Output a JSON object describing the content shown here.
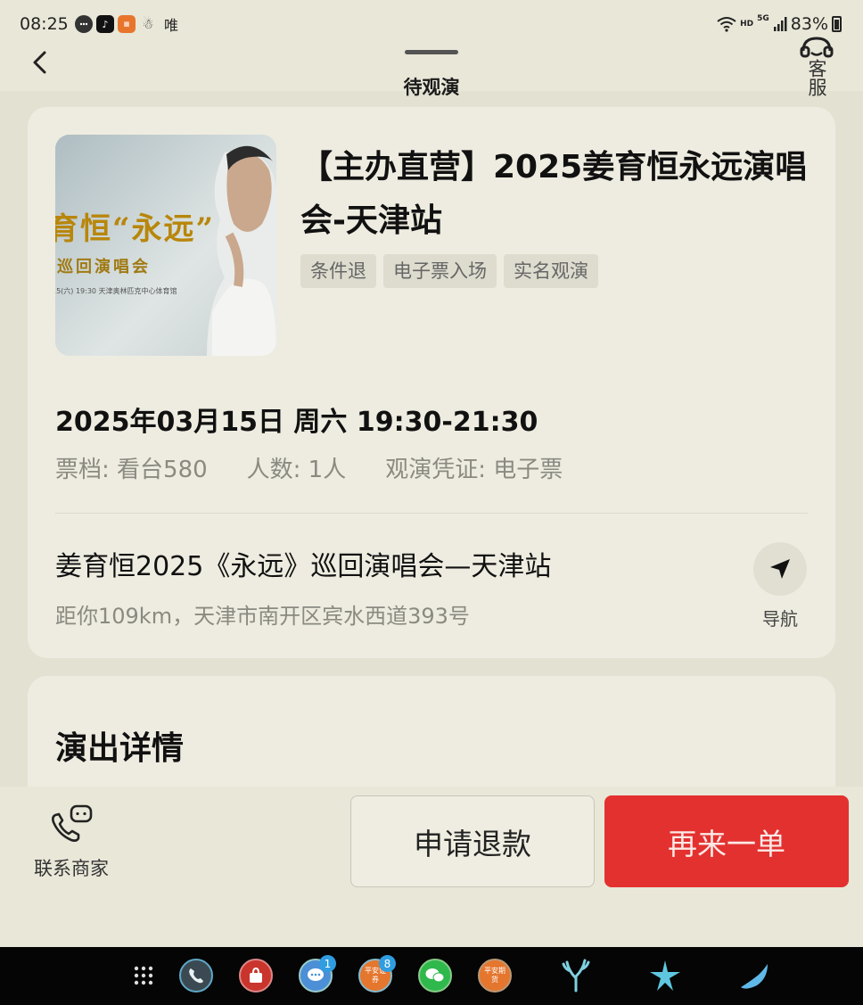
{
  "status_bar": {
    "time": "08:25",
    "carrier_text": "唯",
    "network_hd": "HD",
    "network_gen": "5G",
    "battery": "83%"
  },
  "header": {
    "title": "待观演",
    "customer_service": "客服"
  },
  "event": {
    "title": "【主办直营】2025姜育恒永远演唱会-天津站",
    "tags": [
      "条件退",
      "电子票入场",
      "实名观演"
    ],
    "datetime": "2025年03月15日 周六 19:30-21:30",
    "ticket_tier": "票档: 看台580",
    "people": "人数: 1人",
    "voucher": "观演凭证: 电子票",
    "venue_name": "姜育恒2025《永远》巡回演唱会—天津站",
    "venue_address": "距你109km，天津市南开区宾水西道393号",
    "nav_label": "导航",
    "poster": {
      "text_main": "育恒“永远”",
      "text_sub": "巡回演唱会",
      "text_small": "15(六) 19:30  天津奥林匹克中心体育馆"
    }
  },
  "details": {
    "title": "演出详情"
  },
  "actions": {
    "contact": "联系商家",
    "refund": "申请退款",
    "reorder": "再来一单"
  },
  "dock": {
    "messages_badge": "1",
    "securities_badge": "8",
    "securities_label": "平安证券",
    "futures_label": "平安期货"
  },
  "colors": {
    "primary_red": "#e3312f",
    "background": "#e9e7d8",
    "card": "#eeece0"
  }
}
